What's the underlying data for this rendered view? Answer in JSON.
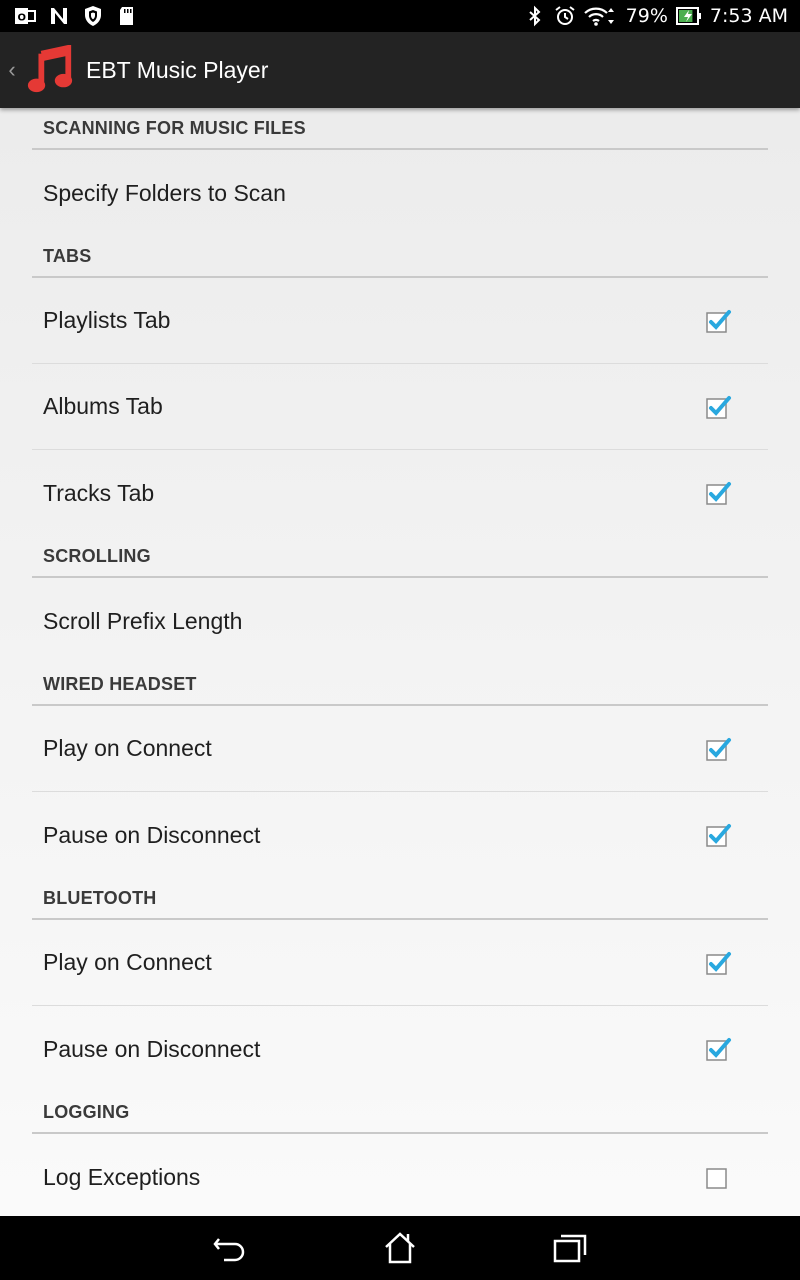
{
  "status_bar": {
    "left_icons": [
      "outlook-icon",
      "n-icon",
      "shield-icon",
      "sd-card-icon"
    ],
    "right_icons": [
      "bluetooth-icon",
      "alarm-icon",
      "wifi-icon"
    ],
    "battery_percent": "79%",
    "battery_level": 0.79,
    "time": "7:53 AM"
  },
  "action_bar": {
    "title": "EBT Music Player",
    "icon": "music-note-icon",
    "icon_color": "#e53935"
  },
  "sections": [
    {
      "header": "SCANNING FOR MUSIC FILES",
      "items": [
        {
          "label": "Specify Folders to Scan",
          "type": "action"
        }
      ]
    },
    {
      "header": "TABS",
      "items": [
        {
          "label": "Playlists Tab",
          "type": "checkbox",
          "checked": true
        },
        {
          "label": "Albums Tab",
          "type": "checkbox",
          "checked": true
        },
        {
          "label": "Tracks Tab",
          "type": "checkbox",
          "checked": true
        }
      ]
    },
    {
      "header": "SCROLLING",
      "items": [
        {
          "label": "Scroll Prefix Length",
          "type": "action"
        }
      ]
    },
    {
      "header": "WIRED HEADSET",
      "items": [
        {
          "label": "Play on Connect",
          "type": "checkbox",
          "checked": true
        },
        {
          "label": "Pause on Disconnect",
          "type": "checkbox",
          "checked": true
        }
      ]
    },
    {
      "header": "BLUETOOTH",
      "items": [
        {
          "label": "Play on Connect",
          "type": "checkbox",
          "checked": true
        },
        {
          "label": "Pause on Disconnect",
          "type": "checkbox",
          "checked": true
        }
      ]
    },
    {
      "header": "LOGGING",
      "items": [
        {
          "label": "Log Exceptions",
          "type": "checkbox",
          "checked": false
        }
      ]
    }
  ],
  "colors": {
    "check_accent": "#29a8df",
    "header_text": "#3a3a3a"
  },
  "nav_bar": {
    "buttons": [
      "back-icon",
      "home-icon",
      "recents-icon"
    ]
  }
}
